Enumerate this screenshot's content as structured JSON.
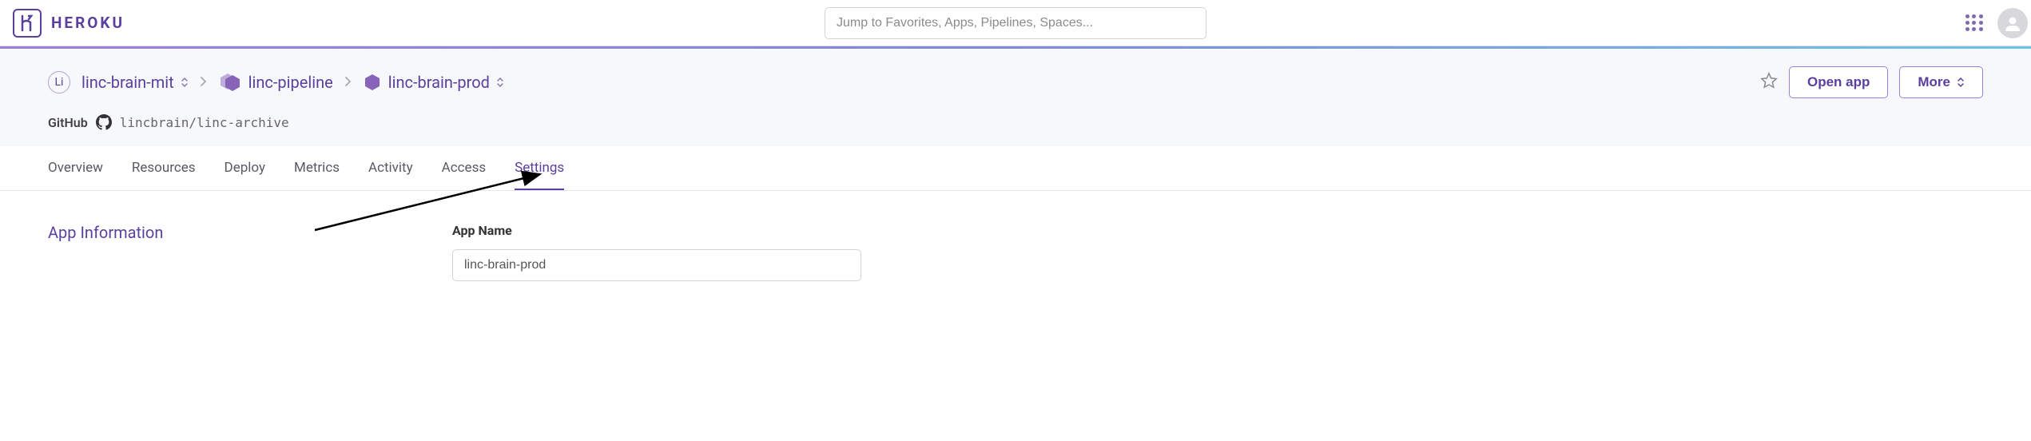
{
  "header": {
    "logo_text": "HEROKU",
    "search_placeholder": "Jump to Favorites, Apps, Pipelines, Spaces..."
  },
  "breadcrumb": {
    "badge_text": "Li",
    "org_name": "linc-brain-mit",
    "pipeline_name": "linc-pipeline",
    "app_name": "linc-brain-prod"
  },
  "actions": {
    "open_app_label": "Open app",
    "more_label": "More"
  },
  "github": {
    "label": "GitHub",
    "repo": "lincbrain/linc-archive"
  },
  "tabs": {
    "items": [
      {
        "label": "Overview",
        "active": false
      },
      {
        "label": "Resources",
        "active": false
      },
      {
        "label": "Deploy",
        "active": false
      },
      {
        "label": "Metrics",
        "active": false
      },
      {
        "label": "Activity",
        "active": false
      },
      {
        "label": "Access",
        "active": false
      },
      {
        "label": "Settings",
        "active": true
      }
    ]
  },
  "settings": {
    "section_title": "App Information",
    "app_name_label": "App Name",
    "app_name_value": "linc-brain-prod"
  },
  "icons": {
    "hex_color": "#8764ba"
  }
}
